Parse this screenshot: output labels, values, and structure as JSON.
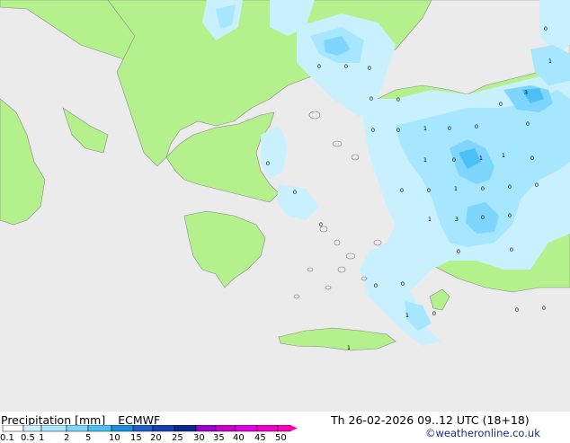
{
  "footer": {
    "title": "Precipitation [mm]",
    "model": "ECMWF",
    "valid_time": "Th 26-02-2026 09..12 UTC (18+18)",
    "copyright": "©weatheronline.co.uk"
  },
  "legend": {
    "labels": [
      "0.1",
      "0.5",
      "1",
      "2",
      "5",
      "10",
      "15",
      "20",
      "25",
      "30",
      "35",
      "40",
      "45",
      "50"
    ],
    "colors": [
      "#ffffff",
      "#c8f0ff",
      "#a6e6ff",
      "#7ed6ff",
      "#4ac0f5",
      "#1d8fe0",
      "#1a5fc8",
      "#1440b0",
      "#0a2a8c",
      "#9a00c8",
      "#c800c8",
      "#e000e0",
      "#f000c8",
      "#ff00b4"
    ]
  },
  "map_colors": {
    "sea": "#ebebeb",
    "land": "#b4f08c",
    "precip_light": "#c8f0ff",
    "precip_mid": "#a6e6ff",
    "precip_heavy": "#7ed6ff",
    "precip_max": "#4ac0f5"
  },
  "values": [
    "0",
    "1",
    "3",
    "0",
    "0",
    "0",
    "0",
    "0",
    "0",
    "0",
    "1",
    "0",
    "0",
    "0",
    "0",
    "1",
    "0",
    "1",
    "1",
    "0",
    "0",
    "0",
    "0",
    "0",
    "1",
    "0",
    "0",
    "0",
    "1",
    "3",
    "0",
    "0",
    "0",
    "0",
    "0",
    "0",
    "0",
    "1",
    "0",
    "1",
    "0",
    "0"
  ]
}
